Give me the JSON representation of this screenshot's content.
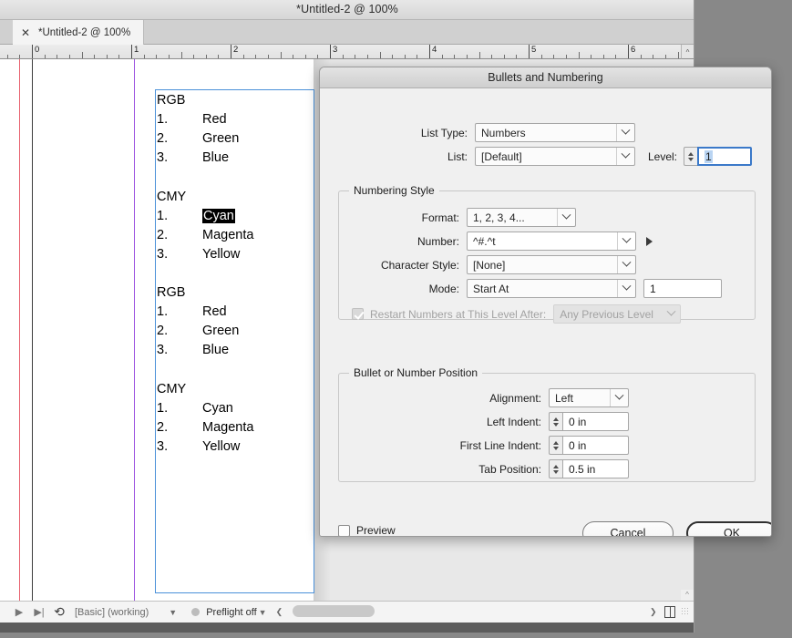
{
  "window": {
    "title": "*Untitled-2 @ 100%",
    "tab": {
      "label": "*Untitled-2 @ 100%",
      "close_icon": "close-icon"
    }
  },
  "ruler": {
    "unit_marks": [
      "0",
      "1",
      "2",
      "3",
      "4",
      "5",
      "6"
    ],
    "corner_glyph": "^"
  },
  "document": {
    "blocks": [
      {
        "heading": "RGB",
        "items": [
          {
            "number": "1.",
            "word": "Red",
            "selected": false
          },
          {
            "number": "2.",
            "word": "Green",
            "selected": false
          },
          {
            "number": "3.",
            "word": "Blue",
            "selected": false
          }
        ]
      },
      {
        "heading": "CMY",
        "items": [
          {
            "number": "1.",
            "word": "Cyan",
            "selected": true
          },
          {
            "number": "2.",
            "word": "Magenta",
            "selected": false
          },
          {
            "number": "3.",
            "word": "Yellow",
            "selected": false
          }
        ]
      },
      {
        "heading": "RGB",
        "items": [
          {
            "number": "1.",
            "word": "Red",
            "selected": false
          },
          {
            "number": "2.",
            "word": "Green",
            "selected": false
          },
          {
            "number": "3.",
            "word": "Blue",
            "selected": false
          }
        ]
      },
      {
        "heading": "CMY",
        "items": [
          {
            "number": "1.",
            "word": "Cyan",
            "selected": false
          },
          {
            "number": "2.",
            "word": "Magenta",
            "selected": false
          },
          {
            "number": "3.",
            "word": "Yellow",
            "selected": false
          }
        ]
      }
    ]
  },
  "statusbar": {
    "page_prev_icon": "play-triangle-icon",
    "page_next_icon": "skip-next-icon",
    "pages_icon": "page-turn-icon",
    "style_value": "[Basic] (working)",
    "style_caret": "chevron-down-icon",
    "preflight_dot": "status-dot-icon",
    "preflight_label": "Preflight off",
    "preflight_caret": "chevron-down-icon",
    "left_collapse": "chevron-left-icon",
    "right_expand": "chevron-right-icon",
    "pane_icon": "split-pane-icon",
    "grip_icon": "resize-grip-icon",
    "scroll_thumb": "horizontal-scrollbar-thumb"
  },
  "dialog": {
    "title": "Bullets and Numbering",
    "list_type": {
      "label": "List Type:",
      "value": "Numbers"
    },
    "list": {
      "label": "List:",
      "value": "[Default]"
    },
    "level": {
      "label": "Level:",
      "value": "1"
    },
    "numbering_style": {
      "legend": "Numbering Style",
      "format": {
        "label": "Format:",
        "value": "1, 2, 3, 4..."
      },
      "number": {
        "label": "Number:",
        "value": "^#.^t",
        "flyout_icon": "flyout-triangle-icon"
      },
      "character_style": {
        "label": "Character Style:",
        "value": "[None]"
      },
      "mode": {
        "label": "Mode:",
        "value": "Start At",
        "number_value": "1"
      },
      "restart": {
        "label": "Restart Numbers at This Level After:",
        "checked": true,
        "enabled": false,
        "value": "Any Previous Level"
      }
    },
    "position": {
      "legend": "Bullet or Number Position",
      "alignment": {
        "label": "Alignment:",
        "value": "Left"
      },
      "left_indent": {
        "label": "Left Indent:",
        "value": "0 in"
      },
      "first_line_indent": {
        "label": "First Line Indent:",
        "value": "0 in"
      },
      "tab_position": {
        "label": "Tab Position:",
        "value": "0.5 in"
      }
    },
    "preview": {
      "label": "Preview",
      "checked": false
    },
    "cancel_label": "Cancel",
    "ok_label": "OK"
  },
  "colors": {
    "guide_pink": "#e8616e",
    "guide_dark": "#3c3c3c",
    "guide_purple": "#9b51e0",
    "frame_blue": "#4a90d9",
    "focus_blue": "#3b79c9",
    "selection_blue": "#b9d4f2",
    "desktop_gray": "#888888"
  }
}
